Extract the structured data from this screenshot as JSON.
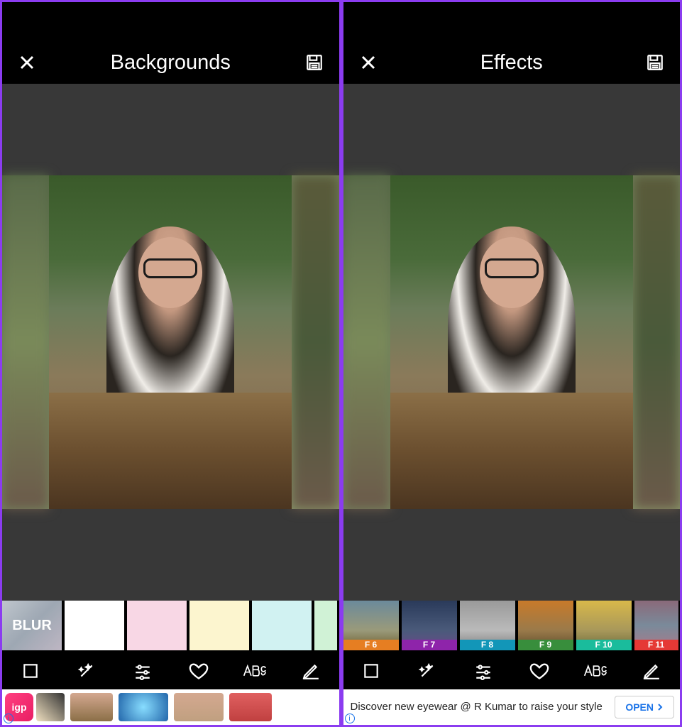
{
  "left": {
    "header": {
      "title": "Backgrounds"
    },
    "options": [
      {
        "label": "BLUR",
        "type": "blur"
      },
      {
        "label": "",
        "color": "#ffffff"
      },
      {
        "label": "",
        "color": "#f8d7e5"
      },
      {
        "label": "",
        "color": "#fcf5cf"
      },
      {
        "label": "",
        "color": "#d1f2f2"
      },
      {
        "label": "",
        "color": "#d0f2d6"
      }
    ],
    "ad": {
      "brand": "igp"
    }
  },
  "right": {
    "header": {
      "title": "Effects"
    },
    "filters": [
      {
        "label": "F 6",
        "color": "#e67e22"
      },
      {
        "label": "F 7",
        "color": "#8e24aa"
      },
      {
        "label": "F 8",
        "color": "#1296b8"
      },
      {
        "label": "F 9",
        "color": "#388e3c"
      },
      {
        "label": "F 10",
        "color": "#1abc9c"
      },
      {
        "label": "F 11",
        "color": "#e53935"
      }
    ],
    "ad": {
      "text": "Discover new eyewear @ R Kumar to raise your style",
      "cta": "OPEN"
    }
  },
  "tools": [
    "crop",
    "magic",
    "sliders",
    "heart",
    "text",
    "pen"
  ]
}
